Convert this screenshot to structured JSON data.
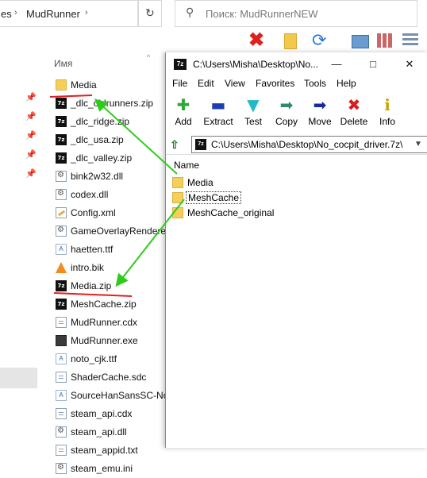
{
  "explorer": {
    "breadcrumb": [
      "es",
      "MudRunner"
    ],
    "search_placeholder": "Поиск: MudRunnerNEW",
    "column_name": "Имя",
    "files": [
      {
        "name": "Media",
        "type": "folder"
      },
      {
        "name": "_dlc_oldrunners.zip",
        "type": "7z"
      },
      {
        "name": "_dlc_ridge.zip",
        "type": "7z"
      },
      {
        "name": "_dlc_usa.zip",
        "type": "7z"
      },
      {
        "name": "_dlc_valley.zip",
        "type": "7z"
      },
      {
        "name": "bink2w32.dll",
        "type": "gear"
      },
      {
        "name": "codex.dll",
        "type": "gear"
      },
      {
        "name": "Config.xml",
        "type": "xml"
      },
      {
        "name": "GameOverlayRenderer",
        "type": "gear"
      },
      {
        "name": "haetten.ttf",
        "type": "font"
      },
      {
        "name": "intro.bik",
        "type": "vlc"
      },
      {
        "name": "Media.zip",
        "type": "7z"
      },
      {
        "name": "MeshCache.zip",
        "type": "7z"
      },
      {
        "name": "MudRunner.cdx",
        "type": "doc"
      },
      {
        "name": "MudRunner.exe",
        "type": "exe"
      },
      {
        "name": "noto_cjk.ttf",
        "type": "font"
      },
      {
        "name": "ShaderCache.sdc",
        "type": "doc"
      },
      {
        "name": "SourceHanSansSC-Nor",
        "type": "font"
      },
      {
        "name": "steam_api.cdx",
        "type": "doc"
      },
      {
        "name": "steam_api.dll",
        "type": "gear"
      },
      {
        "name": "steam_appid.txt",
        "type": "doc"
      },
      {
        "name": "steam_emu.ini",
        "type": "gear"
      }
    ]
  },
  "sevenzip": {
    "title": "C:\\Users\\Misha\\Desktop\\No...",
    "window_buttons": {
      "minimize": "—",
      "maximize": "□",
      "close": "✕"
    },
    "menu": [
      "File",
      "Edit",
      "View",
      "Favorites",
      "Tools",
      "Help"
    ],
    "toolbar": [
      {
        "label": "Add",
        "icon": "plus-icon",
        "glyph": "✚",
        "color": "#2ea836"
      },
      {
        "label": "Extract",
        "icon": "minus-icon",
        "glyph": "▬",
        "color": "#1a3fb0"
      },
      {
        "label": "Test",
        "icon": "check-icon",
        "glyph": "▼",
        "color": "#22b8c8"
      },
      {
        "label": "Copy",
        "icon": "copy-arrow-icon",
        "glyph": "➡",
        "color": "#2d8a6e"
      },
      {
        "label": "Move",
        "icon": "move-arrow-icon",
        "glyph": "➡",
        "color": "#1a2a9c"
      },
      {
        "label": "Delete",
        "icon": "delete-icon",
        "glyph": "✖",
        "color": "#d81e1e"
      },
      {
        "label": "Info",
        "icon": "info-icon",
        "glyph": "i",
        "color": "#c8a400"
      }
    ],
    "path": "C:\\Users\\Misha\\Desktop\\No_cocpit_driver.7z\\",
    "column_name": "Name",
    "items": [
      "Media",
      "MeshCache",
      "MeshCache_original"
    ]
  },
  "annotation_colors": {
    "arrow": "#2ecc1a",
    "underline": "#e02020"
  }
}
